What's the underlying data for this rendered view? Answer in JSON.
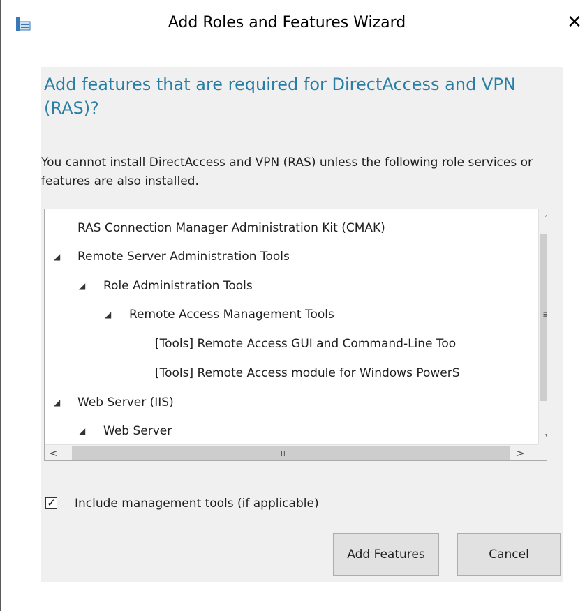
{
  "window": {
    "title": "Add Roles and Features Wizard",
    "close_glyph": "✕"
  },
  "dialog": {
    "heading": "Add features that are required for DirectAccess and VPN (RAS)?",
    "description": "You cannot install DirectAccess and VPN (RAS) unless the following role services or features are also installed."
  },
  "tree": {
    "items": [
      {
        "label": "RAS Connection Manager Administration Kit (CMAK)",
        "expanded": false
      },
      {
        "label": "Remote Server Administration Tools",
        "expanded": true
      },
      {
        "label": "Role Administration Tools",
        "expanded": true
      },
      {
        "label": "Remote Access Management Tools",
        "expanded": true
      },
      {
        "label": "[Tools] Remote Access GUI and Command-Line Too",
        "expanded": false
      },
      {
        "label": "[Tools] Remote Access module for Windows PowerS",
        "expanded": false
      },
      {
        "label": "Web Server (IIS)",
        "expanded": true
      },
      {
        "label": "Web Server",
        "expanded": true
      }
    ],
    "expand_glyph": "◢"
  },
  "options": {
    "include_tools_label": "Include management tools (if applicable)",
    "include_tools_checked": true
  },
  "buttons": {
    "add_features": "Add Features",
    "cancel": "Cancel"
  },
  "icons": {
    "app": "server-manager-icon",
    "close": "close-icon",
    "checkmark": "checkmark-icon"
  }
}
